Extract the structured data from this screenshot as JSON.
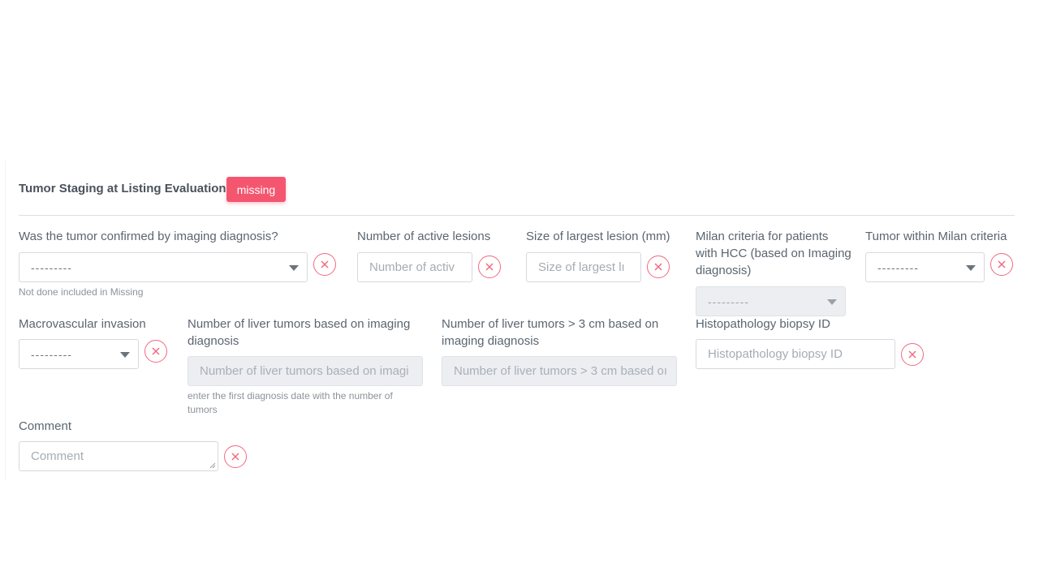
{
  "section": {
    "title": "Tumor Staging at Listing Evaluation",
    "badge": "missing"
  },
  "fields": {
    "imaging_confirmed": {
      "label": "Was the tumor confirmed by imaging diagnosis?",
      "value": "---------",
      "help": "Not done included in Missing"
    },
    "active_lesions": {
      "label": "Number of active lesions",
      "placeholder": "Number of activ"
    },
    "largest_lesion": {
      "label": "Size of largest lesion (mm)",
      "placeholder": "Size of largest lı"
    },
    "milan_hcc": {
      "label_line1": "Milan criteria for patients",
      "label_line2": "with HCC (based on Imaging",
      "label_line3": "diagnosis)",
      "value": "---------"
    },
    "within_milan": {
      "label": "Tumor within Milan criteria",
      "value": "---------"
    },
    "macrovascular": {
      "label": "Macrovascular invasion",
      "value": "---------"
    },
    "num_liver_tumors": {
      "label_line1": "Number of liver tumors based on imaging",
      "label_line2": "diagnosis",
      "placeholder": "Number of liver tumors based on imagi",
      "help_line1": "enter the first diagnosis date with the number of",
      "help_line2": "tumors"
    },
    "num_liver_tumors_3cm": {
      "label_line1": "Number of liver tumors > 3 cm based on",
      "label_line2": "imaging diagnosis",
      "placeholder": "Number of liver tumors > 3 cm based oı"
    },
    "biopsy_id": {
      "label": "Histopathology biopsy ID",
      "placeholder": "Histopathology biopsy ID"
    },
    "comment": {
      "label": "Comment",
      "placeholder": "Comment"
    }
  },
  "colors": {
    "accent": "#f5566f",
    "clear_icon": "#f26a80"
  },
  "icons": {
    "clear": "close-icon",
    "dropdown": "chevron-down-icon"
  }
}
